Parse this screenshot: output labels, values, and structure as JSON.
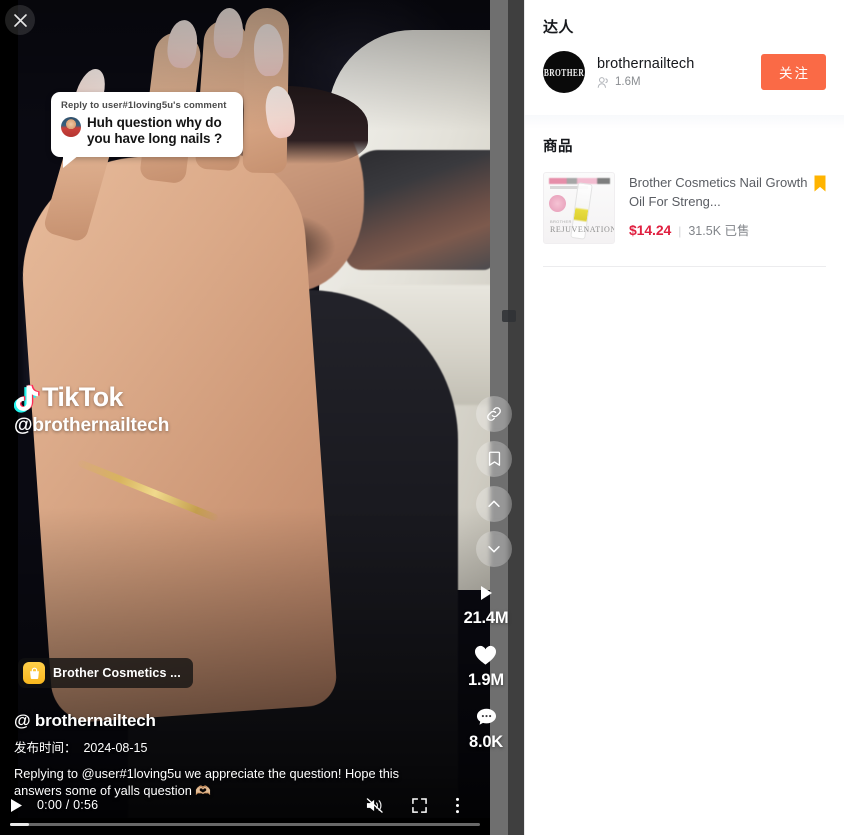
{
  "window": {
    "close_label": "×"
  },
  "video": {
    "reply_bubble": {
      "header": "Reply to user#1loving5u's comment",
      "text": "Huh question why do you have long nails ?"
    },
    "watermark": {
      "brand": "TikTok",
      "handle": "@brothernailtech"
    },
    "rail": [
      {
        "name": "link-icon",
        "label": "link"
      },
      {
        "name": "bookmark-icon",
        "label": "bookmark"
      },
      {
        "name": "chevron-up-icon",
        "label": "previous"
      },
      {
        "name": "chevron-down-icon",
        "label": "next"
      }
    ],
    "stats": [
      {
        "icon": "play-icon",
        "value": "21.4M"
      },
      {
        "icon": "heart-icon",
        "value": "1.9M"
      },
      {
        "icon": "comment-icon",
        "value": "8.0K"
      }
    ],
    "product_pill": {
      "icon": "shopping-bag-icon",
      "label": "Brother Cosmetics ..."
    },
    "meta": {
      "handle": "@ brothernailtech",
      "publish_label": "发布时间：",
      "publish_date": "2024-08-15",
      "description": "Replying to @user#1loving5u we appreciate the question! Hope this answers some of yalls question 🫶🏼"
    },
    "controls": {
      "play_label": "play",
      "time": "0:00 / 0:56",
      "mute_label": "unmute",
      "fullscreen_label": "fullscreen",
      "more_label": "more options",
      "progress_percent": 4
    }
  },
  "info_panel": {
    "author_section": {
      "title": "达人",
      "avatar_text": "BROTHER",
      "name": "brothernailtech",
      "fans_icon": "followers-icon",
      "fans_count": "1.6M",
      "follow_button": "关注",
      "follow_color": "#fa6a46"
    },
    "goods_section": {
      "title": "商品",
      "items": [
        {
          "name": "Brother Cosmetics Nail Growth Oil For Streng...",
          "price": "$14.24",
          "separator": "|",
          "sold": "31.5K 已售",
          "flag_icon": "bookmark-flag-icon",
          "flag_color": "#ffb400",
          "price_color": "#e02040",
          "thumb_text_main": "REJUVENATION.",
          "thumb_text_sub": "BROTHER"
        }
      ]
    }
  }
}
